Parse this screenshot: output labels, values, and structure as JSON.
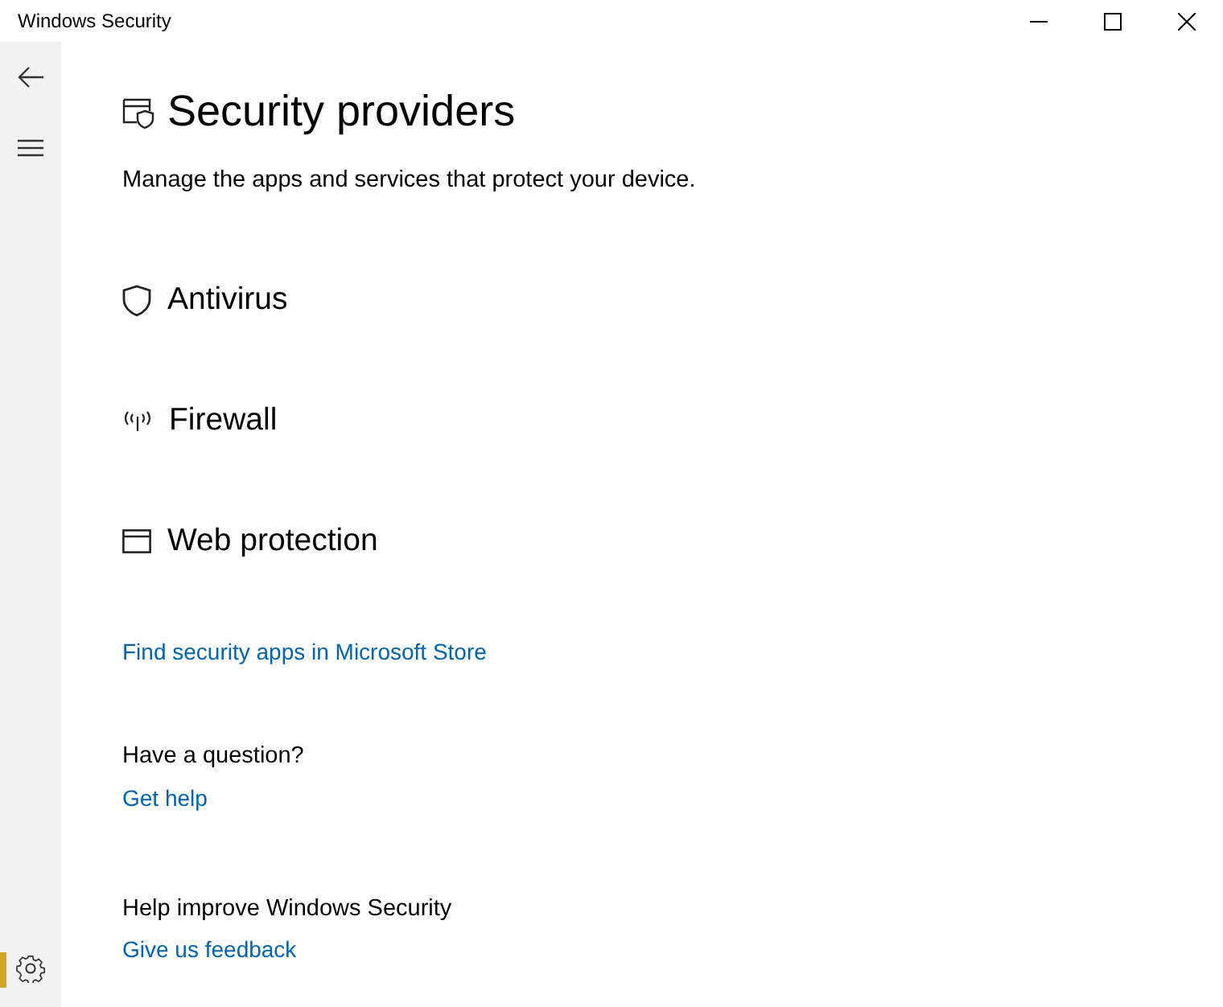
{
  "window": {
    "title": "Windows Security"
  },
  "sidebar": {
    "settings": {
      "selected": true
    }
  },
  "page": {
    "title": "Security providers",
    "subtitle": "Manage the apps and services that protect your device."
  },
  "providers": [
    {
      "kind": "antivirus",
      "label": "Antivirus"
    },
    {
      "kind": "firewall",
      "label": "Firewall"
    },
    {
      "kind": "web",
      "label": "Web protection"
    }
  ],
  "store_link": "Find security apps in Microsoft Store",
  "sections": [
    {
      "heading": "Have a question?",
      "link": "Get help"
    },
    {
      "heading": "Help improve Windows Security",
      "link": "Give us feedback"
    }
  ]
}
